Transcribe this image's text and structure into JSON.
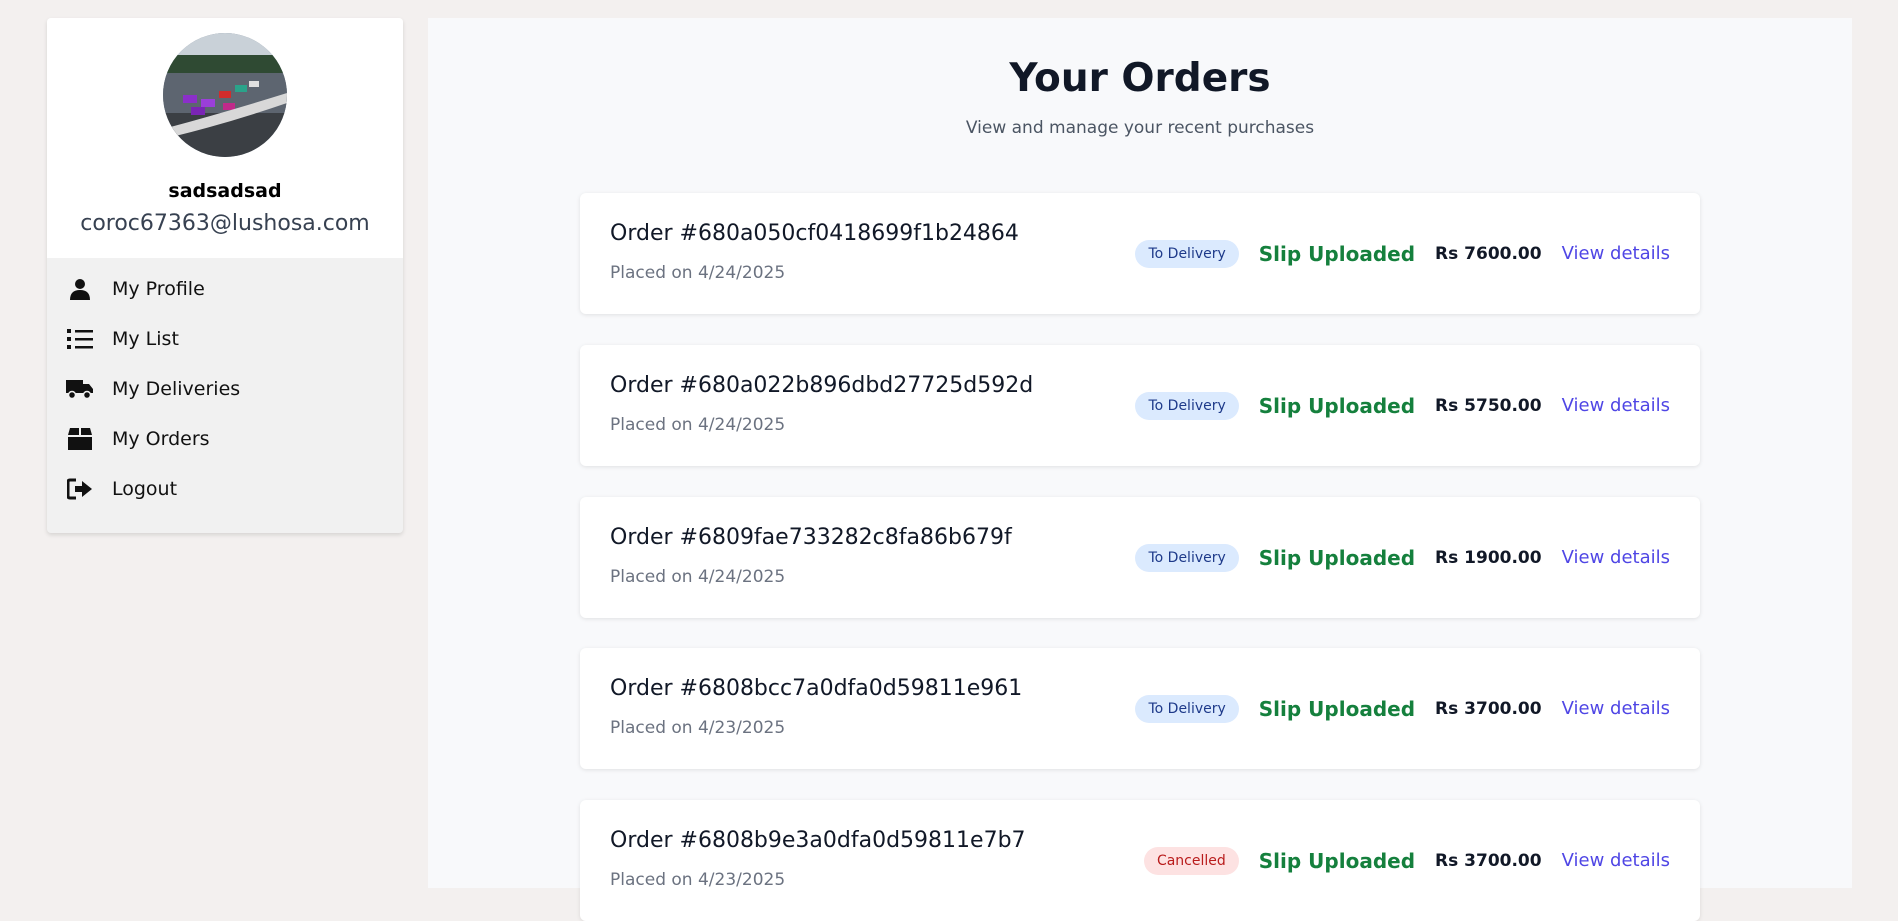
{
  "profile": {
    "username": "sadsadsad",
    "email": "coroc67363@lushosa.com"
  },
  "menu": [
    {
      "label": "My Profile",
      "icon": "user-icon"
    },
    {
      "label": "My List",
      "icon": "list-icon"
    },
    {
      "label": "My Deliveries",
      "icon": "truck-icon"
    },
    {
      "label": "My Orders",
      "icon": "box-icon"
    },
    {
      "label": "Logout",
      "icon": "logout-icon"
    }
  ],
  "page": {
    "title": "Your Orders",
    "subtitle": "View and manage your recent purchases"
  },
  "orders": [
    {
      "id": "Order #680a050cf0418699f1b24864",
      "date": "Placed on 4/24/2025",
      "status": "To Delivery",
      "payment": "Slip Uploaded",
      "total": "Rs 7600.00",
      "link": "View details"
    },
    {
      "id": "Order #680a022b896dbd27725d592d",
      "date": "Placed on 4/24/2025",
      "status": "To Delivery",
      "payment": "Slip Uploaded",
      "total": "Rs 5750.00",
      "link": "View details"
    },
    {
      "id": "Order #6809fae733282c8fa86b679f",
      "date": "Placed on 4/24/2025",
      "status": "To Delivery",
      "payment": "Slip Uploaded",
      "total": "Rs 1900.00",
      "link": "View details"
    },
    {
      "id": "Order #6808bcc7a0dfa0d59811e961",
      "date": "Placed on 4/23/2025",
      "status": "To Delivery",
      "payment": "Slip Uploaded",
      "total": "Rs 3700.00",
      "link": "View details"
    },
    {
      "id": "Order #6808b9e3a0dfa0d59811e7b7",
      "date": "Placed on 4/23/2025",
      "status": "Cancelled",
      "payment": "Slip Uploaded",
      "total": "Rs 3700.00",
      "link": "View details"
    }
  ],
  "colors": {
    "accent": "#4f46e5",
    "success": "#15803d",
    "delivery_badge": "#dbeafe",
    "cancelled_badge": "#fde2e2"
  }
}
